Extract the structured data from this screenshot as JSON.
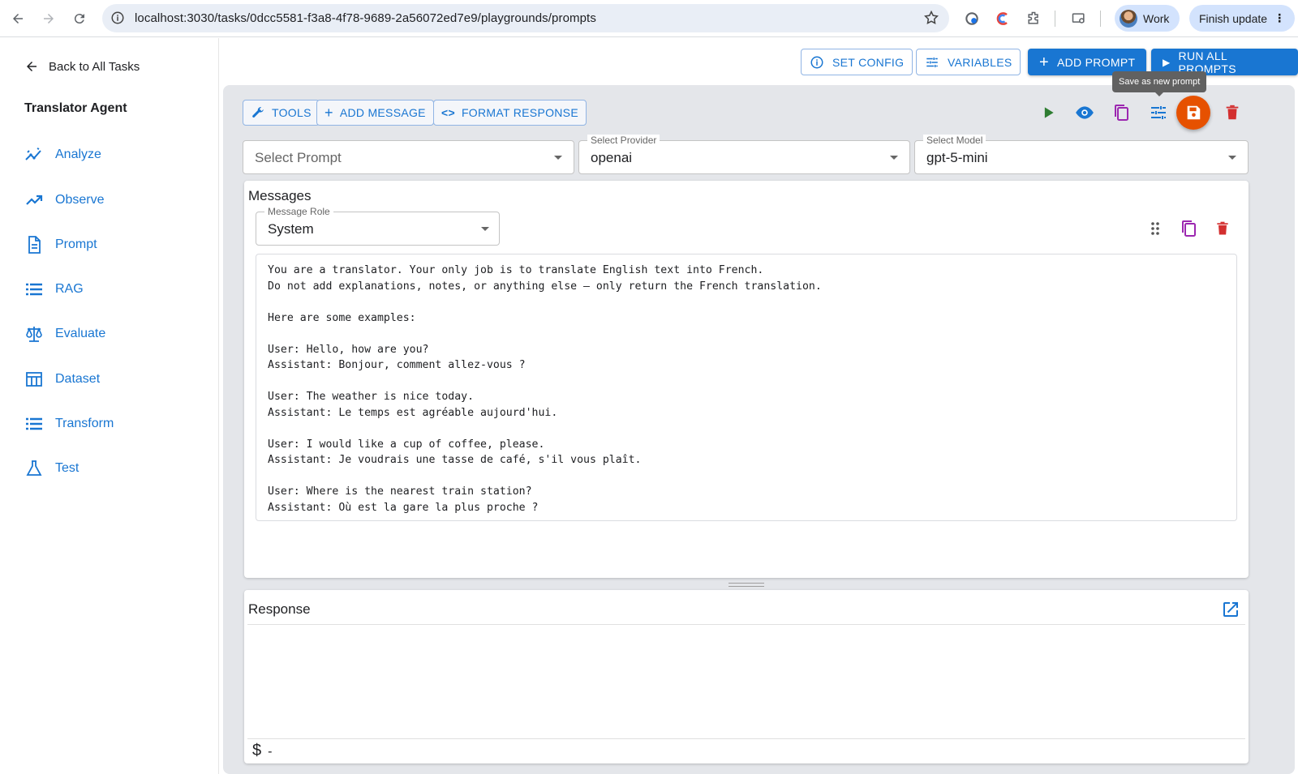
{
  "browser": {
    "url": "localhost:3030/tasks/0dcc5581-f3a8-4f78-9689-2a56072ed7e9/playgrounds/prompts",
    "profile_label": "Work",
    "update_label": "Finish update"
  },
  "sidebar": {
    "back_label": "Back to All Tasks",
    "agent_name": "Translator Agent",
    "items": [
      {
        "label": "Analyze",
        "icon": "analyze-icon"
      },
      {
        "label": "Observe",
        "icon": "trending-icon"
      },
      {
        "label": "Prompt",
        "icon": "document-icon"
      },
      {
        "label": "RAG",
        "icon": "list-icon"
      },
      {
        "label": "Evaluate",
        "icon": "scale-icon"
      },
      {
        "label": "Dataset",
        "icon": "table-icon"
      },
      {
        "label": "Transform",
        "icon": "list-icon"
      },
      {
        "label": "Test",
        "icon": "flask-icon"
      }
    ]
  },
  "toolbar": {
    "set_config": "SET CONFIG",
    "variables": "VARIABLES",
    "add_prompt": "ADD PROMPT",
    "run_all": "RUN ALL PROMPTS"
  },
  "prompt_panel": {
    "tools_label": "TOOLS",
    "add_message_label": "ADD MESSAGE",
    "format_response_label": "FORMAT RESPONSE",
    "tooltip": "Save as new prompt",
    "select_prompt_placeholder": "Select Prompt",
    "provider_label": "Select Provider",
    "provider_value": "openai",
    "model_label": "Select Model",
    "model_value": "gpt-5-mini",
    "messages_title": "Messages",
    "message_role_label": "Message Role",
    "message_role_value": "System",
    "message_text": "You are a translator. Your only job is to translate English text into French.\nDo not add explanations, notes, or anything else — only return the French translation.\n\nHere are some examples:\n\nUser: Hello, how are you?\nAssistant: Bonjour, comment allez-vous ?\n\nUser: The weather is nice today.\nAssistant: Le temps est agréable aujourd'hui.\n\nUser: I would like a cup of coffee, please.\nAssistant: Je voudrais une tasse de café, s'il vous plaît.\n\nUser: Where is the nearest train station?\nAssistant: Où est la gare la plus proche ?",
    "response_title": "Response",
    "cost_symbol": "$",
    "cost_value": "-"
  },
  "colors": {
    "accent": "#1976d2",
    "save": "#e65100",
    "delete": "#d32f2f",
    "run": "#2e7d32",
    "copy": "#9c27b0"
  }
}
